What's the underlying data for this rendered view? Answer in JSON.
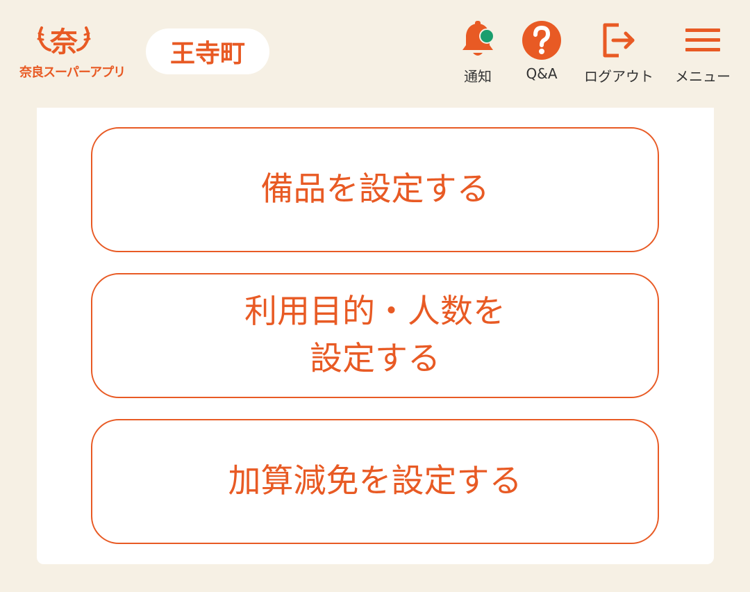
{
  "header": {
    "logo": {
      "mark": "奈",
      "text": "奈良スーパーアプリ"
    },
    "area_name": "王寺町",
    "nav": [
      {
        "label": "通知",
        "icon": "bell-icon",
        "has_badge": true
      },
      {
        "label": "Q&A",
        "icon": "question-icon"
      },
      {
        "label": "ログアウト",
        "icon": "logout-icon"
      },
      {
        "label": "メニュー",
        "icon": "hamburger-menu-icon"
      }
    ]
  },
  "actions": [
    {
      "lines": [
        "備品を設定する"
      ]
    },
    {
      "lines": [
        "利用目的・人数を",
        "設定する"
      ]
    },
    {
      "lines": [
        "加算減免を設定する"
      ]
    }
  ],
  "colors": {
    "accent": "#e85a24",
    "background": "#f6f0e4",
    "badge": "#1a9e6e",
    "card": "#ffffff"
  }
}
